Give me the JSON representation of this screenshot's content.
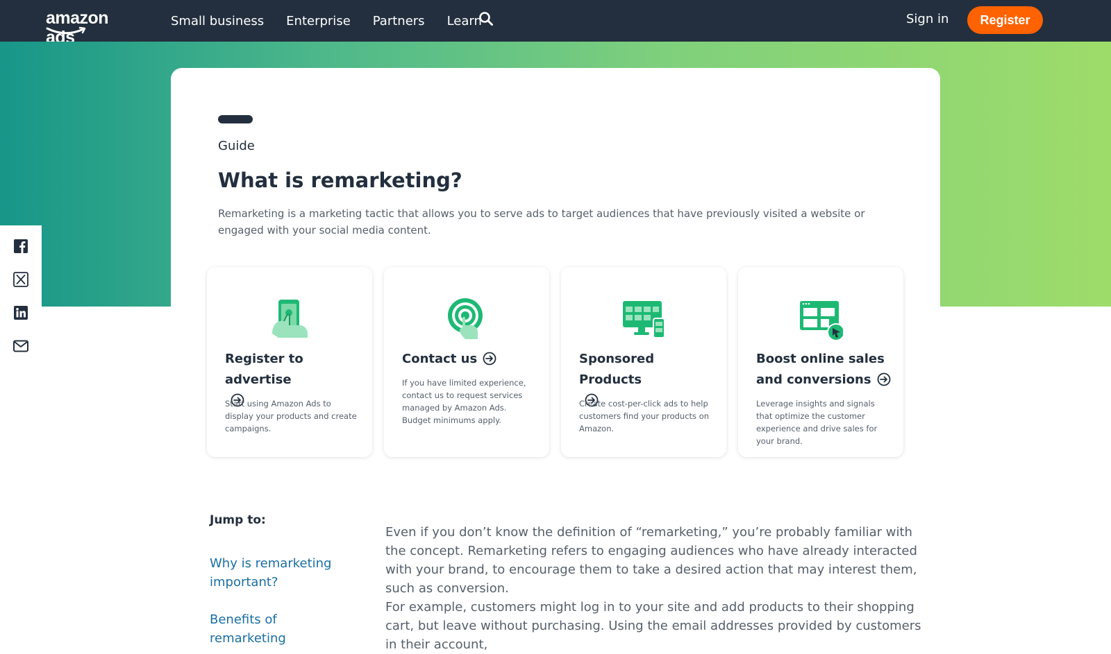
{
  "header": {
    "logo_text": "amazon ads",
    "nav": [
      "Small business",
      "Enterprise",
      "Partners",
      "Learn"
    ],
    "search_icon": "search-icon",
    "sign_in": "Sign in",
    "register": "Register"
  },
  "colors": {
    "header_bg": "#232f3e",
    "accent_orange": "#ff6200",
    "gradient_start": "#179689",
    "gradient_end": "#9edc6a",
    "icon_green": "#1db974",
    "link_blue": "#1a6fa3"
  },
  "share": {
    "icons": [
      "facebook-icon",
      "x-icon",
      "linkedin-icon",
      "email-icon"
    ]
  },
  "hero": {
    "eyebrow": "Guide",
    "title": "What is remarketing?",
    "intro": "Remarketing is a marketing tactic that allows you to serve ads to target audiences that have previously visited a website or engaged with your social media content."
  },
  "cards": [
    {
      "title": "Register to advertise",
      "desc": "Start using Amazon Ads to display your products and create campaigns.",
      "icon": "phone-touch-icon"
    },
    {
      "title": "Contact us",
      "desc": "If you have limited experience, contact us to request services managed by Amazon Ads. Budget minimums apply.",
      "icon": "target-touch-icon"
    },
    {
      "title": "Sponsored Products",
      "desc": "Create cost-per-click ads to help customers find your products on Amazon.",
      "icon": "monitor-devices-icon"
    },
    {
      "title": "Boost online sales and conversions",
      "desc": "Leverage insights and signals that optimize the customer experience and drive sales for your brand.",
      "icon": "browser-cursor-icon"
    }
  ],
  "jump": {
    "label": "Jump to:",
    "links": [
      "Why is remarketing important?",
      "Benefits of remarketing"
    ]
  },
  "body": {
    "p1": "Even if you don’t know the definition of “remarketing,” you’re probably familiar with the concept. Remarketing refers to engaging audiences who have already interacted with your brand, to encourage them to take a desired action that may interest them, such as conversion.",
    "p2": "For example, customers might log in to your site and add products to their shopping cart, but leave without purchasing. Using the email addresses provided by customers in their account,"
  }
}
